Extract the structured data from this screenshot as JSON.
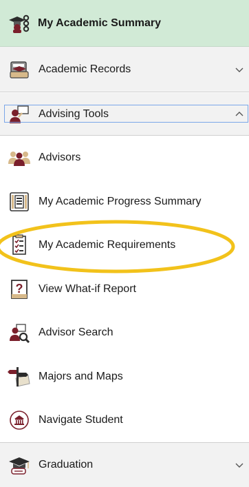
{
  "nav": {
    "summary": {
      "label": "My Academic Summary",
      "icon": "student-summary-icon"
    },
    "records": {
      "label": "Academic Records",
      "icon": "records-folder-icon",
      "state": "collapsed"
    },
    "advising": {
      "label": "Advising Tools",
      "icon": "advising-tools-icon",
      "state": "expanded"
    },
    "advising_items": [
      {
        "label": "Advisors",
        "icon": "advisors-people-icon"
      },
      {
        "label": "My Academic Progress Summary",
        "icon": "progress-document-icon"
      },
      {
        "label": "My Academic Requirements",
        "icon": "requirements-checklist-icon",
        "highlighted": true
      },
      {
        "label": "View What-if Report",
        "icon": "what-if-question-icon"
      },
      {
        "label": "Advisor Search",
        "icon": "advisor-search-icon"
      },
      {
        "label": "Majors and Maps",
        "icon": "signpost-map-icon"
      },
      {
        "label": "Navigate Student",
        "icon": "navigate-building-icon"
      }
    ],
    "graduation": {
      "label": "Graduation",
      "icon": "graduation-cap-icon",
      "state": "collapsed"
    }
  },
  "colors": {
    "active_bg": "#d1ead6",
    "section_bg": "#f2f2f2",
    "maroon": "#7a1f2b",
    "highlight_ring": "#f2c21b"
  }
}
